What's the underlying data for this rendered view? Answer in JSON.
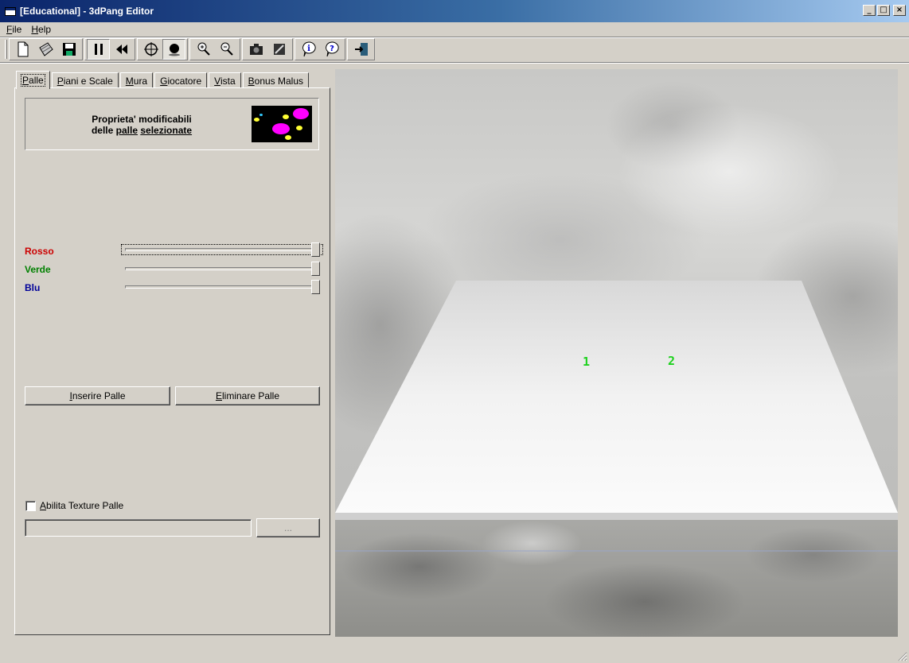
{
  "window": {
    "title": "[Educational] - 3dPang Editor",
    "buttons": [
      "_",
      "□",
      "×"
    ]
  },
  "menu": {
    "items": [
      "File",
      "Help"
    ]
  },
  "toolbar": {
    "groups": [
      [
        "new-file-icon",
        "open-file-icon",
        "save-file-icon"
      ],
      [
        "pause-icon",
        "rewind-icon"
      ],
      [
        "crosshair-icon",
        "ball-icon"
      ],
      [
        "zoom-in-icon",
        "zoom-out-icon"
      ],
      [
        "camera-icon",
        "screenshot-icon"
      ],
      [
        "info-icon",
        "help-icon"
      ],
      [
        "exit-icon"
      ]
    ]
  },
  "tabs": [
    "Palle",
    "Piani e Scale",
    "Mura",
    "Giocatore",
    "Vista",
    "Bonus Malus"
  ],
  "active_tab": "Palle",
  "info": {
    "line1": "Proprieta' modificabili",
    "line2_prefix": "delle ",
    "line2_word1": "palle",
    "line2_word2": "selezionate"
  },
  "sliders": [
    {
      "label": "Rosso",
      "color": "#cc0000",
      "value_fraction": 1.0
    },
    {
      "label": "Verde",
      "color": "#008000",
      "value_fraction": 1.0
    },
    {
      "label": "Blu",
      "color": "#000099",
      "value_fraction": 1.0
    }
  ],
  "buttons": {
    "insert": "Inserire Palle",
    "delete": "Eliminare Palle",
    "browse": "..."
  },
  "texture": {
    "checkbox_label": "Abilita Texture Palle",
    "checked": false,
    "path_value": ""
  },
  "scene": {
    "labels": [
      "1",
      "2"
    ],
    "label_color": "#1dd11d"
  }
}
